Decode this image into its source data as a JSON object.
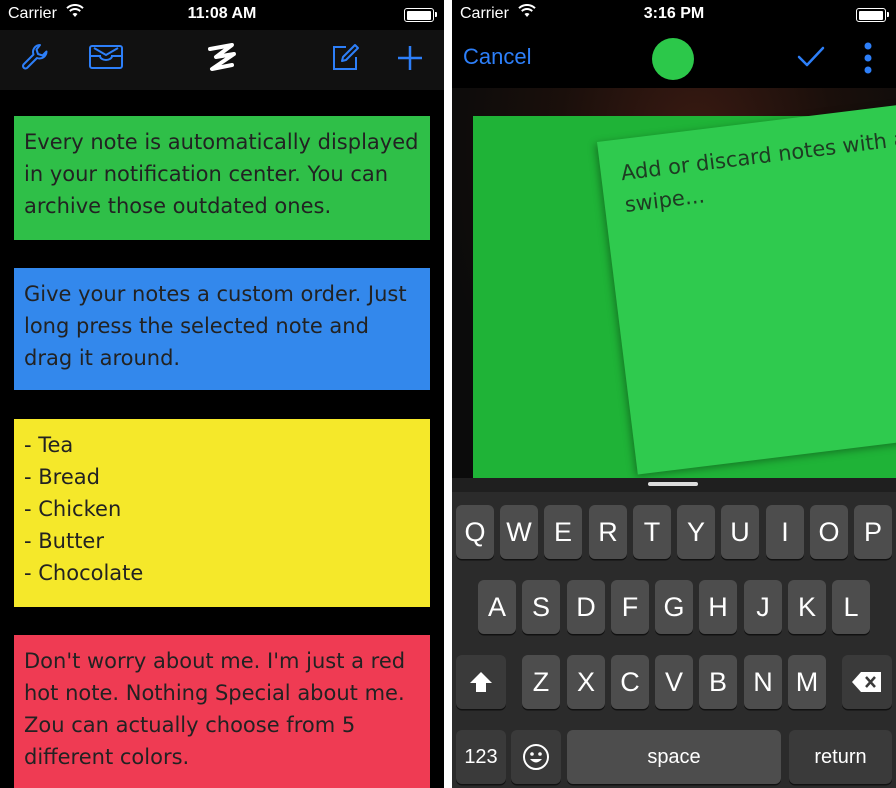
{
  "left": {
    "status": {
      "carrier": "Carrier",
      "time": "11:08 AM",
      "battery_level": 1.0
    },
    "nav": {
      "icons": [
        "wrench-icon",
        "inbox-icon",
        "app-logo-icon",
        "compose-icon",
        "plus-icon"
      ],
      "accent": "#2d7ff9"
    },
    "notes": [
      {
        "color": "#2fbf48",
        "text": "Every note is automatically displayed\nin your notification center. You can\narchive those outdated ones."
      },
      {
        "color": "#3388ec",
        "text": "Give your notes a custom order. Just\nlong press the selected note and\ndrag it around."
      },
      {
        "color": "#f5e82a",
        "text": "- Tea\n- Bread\n- Chicken\n- Butter\n- Chocolate"
      },
      {
        "color": "#ef3b53",
        "text": "Don't worry about me. I'm just a red\nhot note. Nothing Special about me.\nZou can actually choose from 5\ndifferent colors."
      }
    ]
  },
  "right": {
    "status": {
      "carrier": "Carrier",
      "time": "3:16 PM",
      "battery_level": 1.0
    },
    "nav": {
      "cancel_label": "Cancel",
      "selected_color": "#2cc84a",
      "icons": [
        "checkmark-icon",
        "more-vertical-icon"
      ]
    },
    "note": {
      "text": "Add or discard notes with a\nswipe...",
      "back_color": "#1fb337",
      "front_color": "#2fca4e"
    },
    "keyboard": {
      "row1": [
        "Q",
        "W",
        "E",
        "R",
        "T",
        "Y",
        "U",
        "I",
        "O",
        "P"
      ],
      "row2": [
        "A",
        "S",
        "D",
        "F",
        "G",
        "H",
        "J",
        "K",
        "L"
      ],
      "row3": [
        "Z",
        "X",
        "C",
        "V",
        "B",
        "N",
        "M"
      ],
      "numbers_label": "123",
      "space_label": "space",
      "return_label": "return"
    }
  }
}
